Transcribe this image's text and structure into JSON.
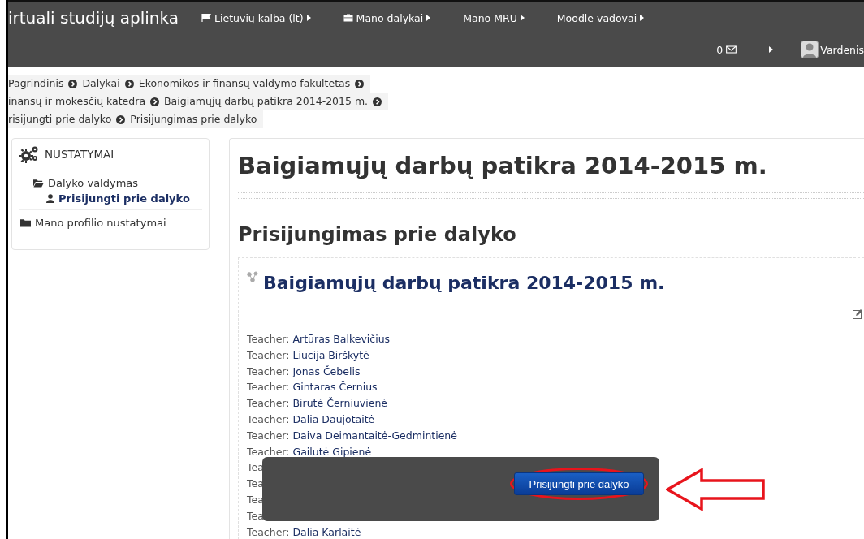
{
  "navbar": {
    "brand": "irtuali studijų aplinka",
    "menu": [
      {
        "label": "Lietuvių kalba (lt)",
        "kind": "flag"
      },
      {
        "label": "Mano dalykai",
        "kind": "briefcase"
      },
      {
        "label": "Mano MRU",
        "kind": "plain"
      },
      {
        "label": "Moodle vadovai",
        "kind": "plain"
      }
    ],
    "messages_count": "0",
    "user_name": "Vardenis"
  },
  "breadcrumbs": [
    [
      "Pagrindinis",
      "Dalykai",
      "Ekonomikos ir finansų valdymo fakultetas"
    ],
    [
      "inansų ir mokesčių katedra",
      "Baigiamųjų darbų patikra 2014-2015 m."
    ],
    [
      "risijungti prie dalyko",
      "Prisijungimas prie dalyko"
    ]
  ],
  "settings_block": {
    "title": "NUSTATYMAI",
    "items": [
      {
        "label": "Dalyko valdymas",
        "kind": "folder-open",
        "selected": false,
        "children": [
          {
            "label": "Prisijungti prie dalyko",
            "kind": "user",
            "selected": true
          }
        ]
      },
      {
        "label": "Mano profilio nustatymai",
        "kind": "folder",
        "selected": false
      }
    ]
  },
  "page_title": "Baigiamųjų darbų patikra 2014-2015 m.",
  "section_title": "Prisijungimas prie dalyko",
  "course": {
    "title": "Baigiamųjų darbų patikra 2014-2015 m.",
    "teachers": [
      {
        "label": "Teacher:",
        "name": "Artūras Balkevičius"
      },
      {
        "label": "Teacher:",
        "name": "Liucija Birškytė"
      },
      {
        "label": "Teacher:",
        "name": "Jonas Čebelis"
      },
      {
        "label": "Teacher:",
        "name": "Gintaras Černius"
      },
      {
        "label": "Teacher:",
        "name": "Birutė Černiuvienė"
      },
      {
        "label": "Teacher:",
        "name": "Dalia Daujotaitė"
      },
      {
        "label": "Teacher:",
        "name": "Daiva Deimantaitė-Gedmintienė"
      },
      {
        "label": "Teacher:",
        "name": "Gailutė Gipienė"
      },
      {
        "label": "Tea"
      },
      {
        "label": "Tea"
      },
      {
        "label": "Tea"
      },
      {
        "label": "Tea"
      },
      {
        "label": "Teacher:",
        "name": "Dalia Karlaitė"
      }
    ]
  },
  "enrol_button": "Prisijungti prie dalyko"
}
